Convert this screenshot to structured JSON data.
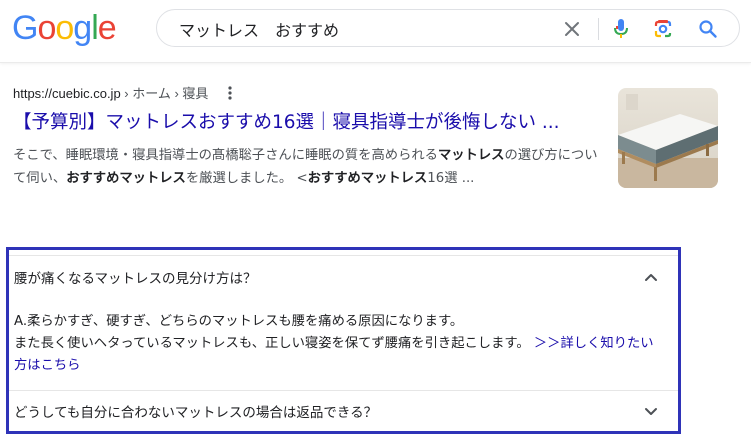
{
  "logo": {
    "letters": [
      "G",
      "o",
      "o",
      "g",
      "l",
      "e"
    ],
    "colors": [
      "#4285f4",
      "#ea4335",
      "#fbbc05",
      "#4285f4",
      "#34a853",
      "#ea4335"
    ]
  },
  "search": {
    "query": "マットレス　おすすめ"
  },
  "icons": {
    "clear": "close-icon",
    "voice": "microphone-icon",
    "lens": "camera-lens-icon",
    "search": "search-icon",
    "more": "more-vert-icon"
  },
  "result": {
    "url": "https://cuebic.co.jp",
    "breadcrumb": " › ホーム › 寝具",
    "title": "【予算別】マットレスおすすめ16選｜寝具指導士が後悔しない ...",
    "snippet_parts": [
      {
        "text": "そこで、睡眠環境・寝具指導士の髙橋聡子さんに睡眠の質を高められる",
        "bold": false
      },
      {
        "text": "マットレス",
        "bold": true
      },
      {
        "text": "の選び方について伺い、",
        "bold": false
      },
      {
        "text": "おすすめマットレス",
        "bold": true
      },
      {
        "text": "を厳選しました。 <",
        "bold": false
      },
      {
        "text": "おすすめマットレス",
        "bold": true
      },
      {
        "text": "16選 ...",
        "bold": false
      }
    ]
  },
  "faq": {
    "items": [
      {
        "question": "腰が痛くなるマットレスの見分け方は？",
        "expanded": true,
        "answer_line1": "A.柔らかすぎ、硬すぎ、どちらのマットレスも腰を痛める原因になります。",
        "answer_line2": "また長く使いヘタっているマットレスも、正しい寝姿を保てず腰痛を引き起こします。",
        "answer_link": " ＞＞詳しく知りたい方はこちら"
      },
      {
        "question": "どうしても自分に合わないマットレスの場合は返品できる？",
        "expanded": false
      }
    ]
  },
  "colors": {
    "link": "#1a0dab",
    "highlight_border": "#2f33b8",
    "accent_blue": "#4285f4"
  }
}
